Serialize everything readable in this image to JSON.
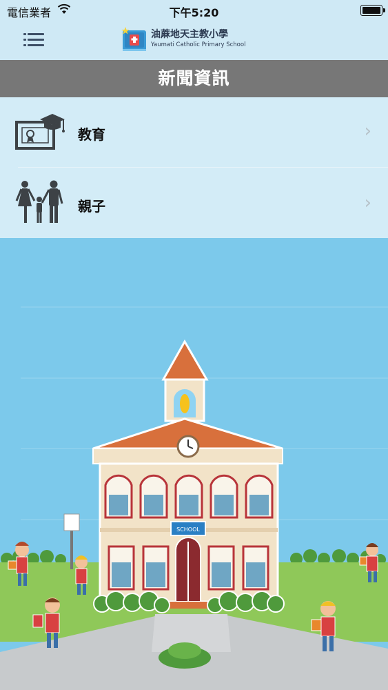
{
  "status_bar": {
    "carrier": "電信業者",
    "time": "下午5:20"
  },
  "header": {
    "school_name": "油蔴地天主教小學",
    "school_name_en": "Yaumati Catholic Primary School"
  },
  "page": {
    "title": "新聞資訊"
  },
  "list": {
    "items": [
      {
        "label": "教育",
        "icon": "graduation-certificate-icon"
      },
      {
        "label": "親子",
        "icon": "family-icon"
      }
    ]
  },
  "illustration": {
    "school_sign": "SCHOOL"
  },
  "colors": {
    "header_bg": "#cfe9f5",
    "title_bar_bg": "#777777",
    "list_bg": "#d3ecf7",
    "sky": "#7cc9eb",
    "grass": "#8fc859"
  }
}
